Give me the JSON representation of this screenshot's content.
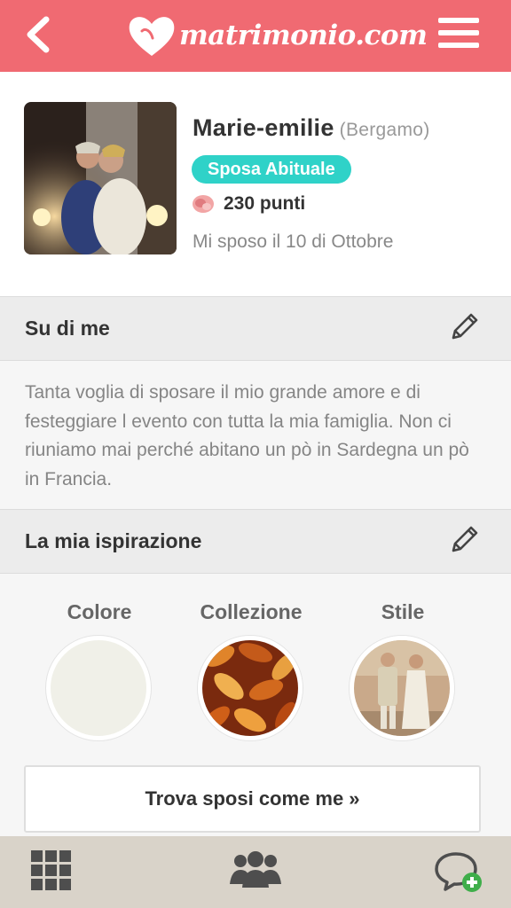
{
  "header": {
    "logo_text": "matrimonio.com"
  },
  "profile": {
    "name": "Marie-emilie",
    "city": "(Bergamo)",
    "badge": "Sposa Abituale",
    "points": "230 punti",
    "wedding_date": "Mi sposo il 10 di Ottobre"
  },
  "about": {
    "title": "Su di me",
    "text": "Tanta voglia di sposare il mio grande amore e di festeggiare l evento con tutta la mia famiglia. Non ci riuniamo mai perché abitano un pò in Sardegna un pò in Francia."
  },
  "inspiration": {
    "title": "La mia ispirazione",
    "items": [
      {
        "label": "Colore"
      },
      {
        "label": "Collezione"
      },
      {
        "label": "Stile"
      }
    ],
    "find_button": "Trova sposi come me »"
  },
  "colors": {
    "header": "#f06a72",
    "badge": "#2fd2c8",
    "tabbar": "#d9d3c9",
    "chosen_color": "#f0f0e8"
  },
  "icons": {
    "back": "chevron-left-icon",
    "menu": "hamburger-icon",
    "edit": "pencil-icon",
    "grid": "grid-icon",
    "community": "people-icon",
    "chat": "chat-add-icon"
  }
}
